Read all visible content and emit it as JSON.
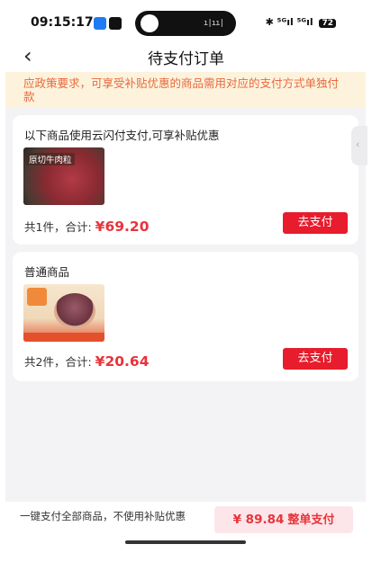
{
  "status_bar": {
    "time": "09:15:17",
    "right_indicators": "✱ ⁵ᴳıl ⁵ᴳıl",
    "battery": "72"
  },
  "navbar": {
    "back_icon": "chevron-left",
    "title": "待支付订单"
  },
  "notice": {
    "text": "应政策要求，可享受补贴优惠的商品需用对应的支付方式单独付款"
  },
  "orders": [
    {
      "section_title": "以下商品使用云闪付支付,可享补贴优惠",
      "thumbnail_label": "原切牛肉粒",
      "count_label": "共1件，合计:",
      "price": "¥69.20",
      "button_label": "去支付"
    },
    {
      "section_title": "普通商品",
      "count_label": "共2件，合计:",
      "price": "¥20.64",
      "button_label": "去支付"
    }
  ],
  "footer": {
    "description": "一键支付全部商品，不使用补贴优惠",
    "total_amount": "¥ 89.84",
    "total_button_label": "整单支付"
  },
  "colors": {
    "accent_red": "#e71c2c",
    "price_red": "#e8343a",
    "notice_bg": "#fdf3dc",
    "notice_text": "#e8683e",
    "footer_button_bg": "#fde6ea"
  }
}
